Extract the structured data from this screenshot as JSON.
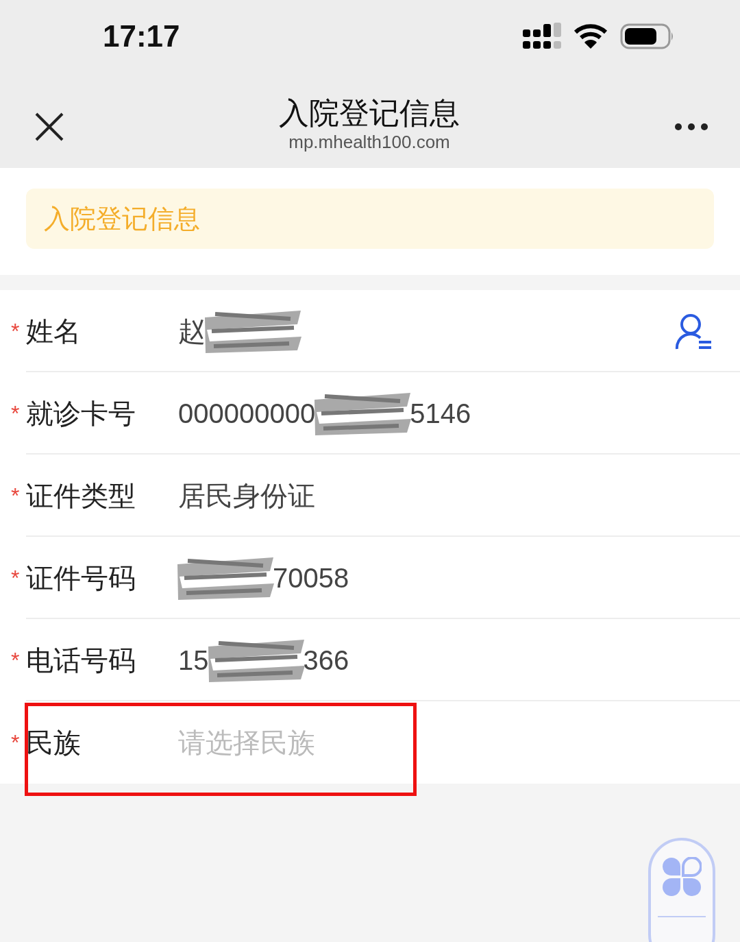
{
  "status_bar": {
    "time": "17:17"
  },
  "nav": {
    "title": "入院登记信息",
    "subtitle": "mp.mhealth100.com"
  },
  "banner": {
    "text": "入院登记信息"
  },
  "fields": [
    {
      "marker": "*",
      "label": "姓名",
      "highlighted": false,
      "has_contact_icon": true,
      "value_parts": [
        {
          "kind": "text",
          "text": "赵"
        },
        {
          "kind": "redaction"
        }
      ]
    },
    {
      "marker": "*",
      "label": "就诊卡号",
      "highlighted": false,
      "has_contact_icon": false,
      "value_parts": [
        {
          "kind": "text",
          "text": "000000000"
        },
        {
          "kind": "redaction"
        },
        {
          "kind": "text",
          "text": "5146"
        }
      ]
    },
    {
      "marker": "*",
      "label": "证件类型",
      "highlighted": false,
      "has_contact_icon": false,
      "value_parts": [
        {
          "kind": "text",
          "text": "居民身份证"
        }
      ]
    },
    {
      "marker": "*",
      "label": "证件号码",
      "highlighted": false,
      "has_contact_icon": false,
      "value_parts": [
        {
          "kind": "redaction"
        },
        {
          "kind": "text",
          "text": "70058"
        }
      ]
    },
    {
      "marker": "*",
      "label": "电话号码",
      "highlighted": false,
      "has_contact_icon": false,
      "value_parts": [
        {
          "kind": "text",
          "text": "15"
        },
        {
          "kind": "redaction"
        },
        {
          "kind": "text",
          "text": "366"
        }
      ]
    },
    {
      "marker": "*",
      "label": "民族",
      "highlighted": true,
      "has_contact_icon": false,
      "placeholder": "请选择民族"
    }
  ]
}
